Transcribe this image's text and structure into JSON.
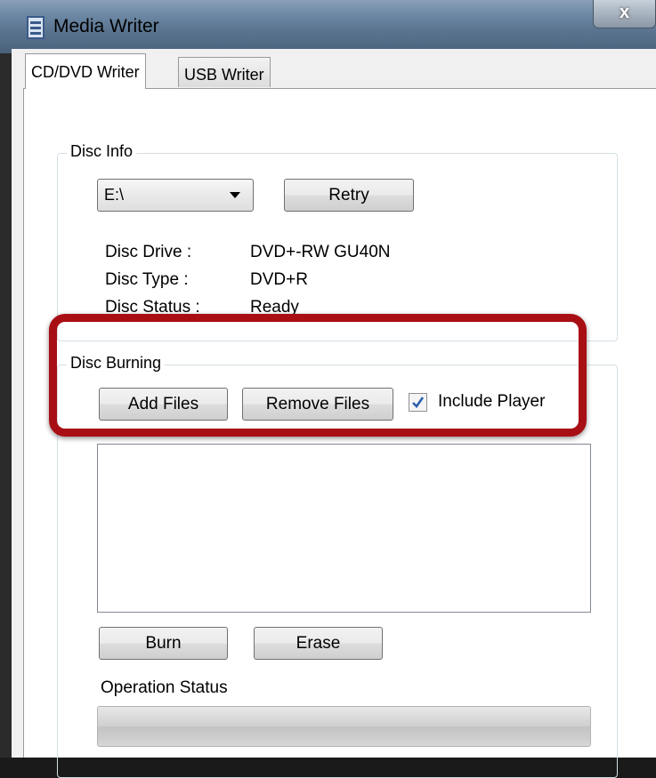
{
  "window": {
    "title": "Media Writer",
    "close_label": "x"
  },
  "tabs": [
    {
      "label": "CD/DVD Writer",
      "selected": true
    },
    {
      "label": "USB Writer",
      "selected": false
    }
  ],
  "disc_info": {
    "legend": "Disc Info",
    "drive_select": {
      "value": "E:\\"
    },
    "retry_label": "Retry",
    "rows": [
      {
        "label": "Disc Drive :",
        "value": "DVD+-RW GU40N"
      },
      {
        "label": "Disc Type :",
        "value": "DVD+R"
      },
      {
        "label": "Disc Status :",
        "value": "Ready"
      }
    ]
  },
  "disc_burning": {
    "legend": "Disc Burning",
    "add_files_label": "Add Files",
    "remove_files_label": "Remove Files",
    "include_player": {
      "label": "Include Player",
      "checked": true
    },
    "burn_label": "Burn",
    "erase_label": "Erase",
    "operation_status_label": "Operation Status",
    "progress": 0
  },
  "colors": {
    "highlight": "#a80f14",
    "checkmark": "#2a5fb0"
  }
}
